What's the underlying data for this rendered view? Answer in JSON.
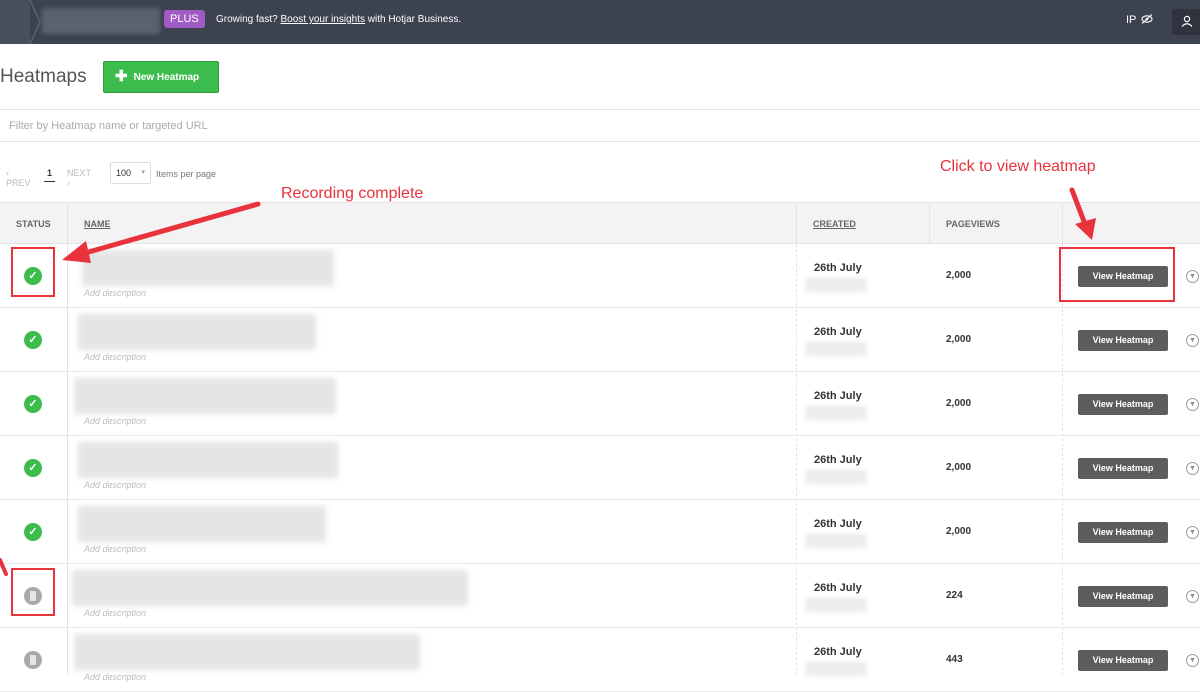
{
  "topbar": {
    "plus_badge": "PLUS",
    "promo_prefix": "Growing fast? ",
    "promo_link": "Boost your insights",
    "promo_suffix": " with Hotjar Business.",
    "ip_label": "IP",
    "ip_icon": "eye-slash-icon",
    "user_icon": "user-icon"
  },
  "header": {
    "title": "Heatmaps",
    "new_button_label": "New Heatmap",
    "new_button_color": "#3cbc4c"
  },
  "filter": {
    "placeholder": "Filter by Heatmap name or targeted URL"
  },
  "pagination": {
    "prev_label": "‹ PREV",
    "page": "1",
    "next_label": "NEXT ›",
    "per_page": "100",
    "per_page_label": "Items per page"
  },
  "table": {
    "columns": [
      "STATUS",
      "NAME",
      "CREATED",
      "PAGEVIEWS"
    ],
    "add_description": "Add description",
    "view_button_label": "View Heatmap",
    "rows": [
      {
        "status": "complete",
        "created": "26th July",
        "pageviews": "2,000"
      },
      {
        "status": "complete",
        "created": "26th July",
        "pageviews": "2,000"
      },
      {
        "status": "complete",
        "created": "26th July",
        "pageviews": "2,000"
      },
      {
        "status": "complete",
        "created": "26th July",
        "pageviews": "2,000"
      },
      {
        "status": "complete",
        "created": "26th July",
        "pageviews": "2,000"
      },
      {
        "status": "recording",
        "created": "26th July",
        "pageviews": "224"
      },
      {
        "status": "recording",
        "created": "26th July",
        "pageviews": "443"
      }
    ]
  },
  "annotations": {
    "recording_complete": "Recording complete",
    "click_to_view": "Click to view heatmap",
    "color": "#e8323c"
  }
}
